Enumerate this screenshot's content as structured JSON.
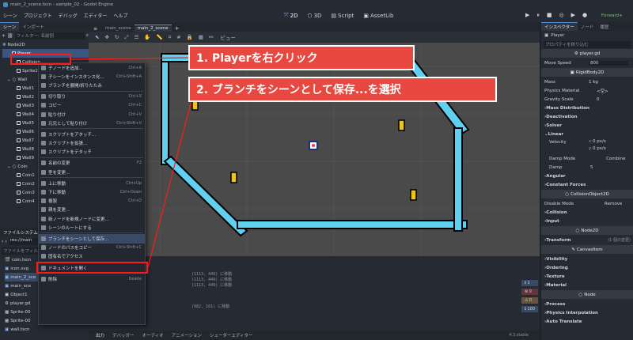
{
  "window": {
    "title": "main_2_scene.tscn - sample_02 - Godot Engine"
  },
  "menubar": {
    "items": [
      "シーン",
      "プロジェクト",
      "デバッグ",
      "エディター",
      "ヘルプ"
    ],
    "workspaces": [
      "2D",
      "3D",
      "Script",
      "AssetLib"
    ],
    "renderer": "Forward+"
  },
  "scene_dock": {
    "tabs": [
      "シーン",
      "インポート"
    ],
    "filter": "フィルター: 名前別",
    "root": "Node2D",
    "nodes": [
      "Player",
      "Collision",
      "Sprite2",
      "Wall",
      "Wall1",
      "Wall2",
      "Wall3",
      "Wall4",
      "Wall5",
      "Wall6",
      "Wall7",
      "Wall8",
      "Wall9",
      "Coin",
      "Coin1",
      "Coin2",
      "Coin3",
      "Coin4"
    ]
  },
  "filesystem": {
    "title": "ファイルシステム",
    "path": "res://main",
    "filter": "ファイルをフィル",
    "files": [
      "coin.tscn",
      "icon.svg",
      "main_2_sce",
      "main_sce",
      "Object1",
      "player.gd",
      "Sprite-00",
      "Sprite-00",
      "wall.tscn"
    ]
  },
  "editor_tabs": [
    "main_scene",
    "main_2_scene"
  ],
  "toolbar": {
    "view": "ビュー"
  },
  "context_menu": [
    {
      "label": "子ノードを追加...",
      "shortcut": "Ctrl+A"
    },
    {
      "label": "子シーンをインスタンス化...",
      "shortcut": "Ctrl+Shift+A"
    },
    {
      "label": "ブランチを展開/折りたたみ",
      "shortcut": ""
    },
    {
      "sep": true
    },
    {
      "label": "切り取り",
      "shortcut": "Ctrl+X"
    },
    {
      "label": "コピー",
      "shortcut": "Ctrl+C"
    },
    {
      "label": "貼り付け",
      "shortcut": "Ctrl+V"
    },
    {
      "label": "元兄として貼り付け",
      "shortcut": "Ctrl+Shift+V"
    },
    {
      "sep": true
    },
    {
      "label": "スクリプトをアタッチ...",
      "shortcut": ""
    },
    {
      "label": "スクリプトを拡張...",
      "shortcut": ""
    },
    {
      "label": "スクリプトをデタッチ",
      "shortcut": ""
    },
    {
      "sep": true
    },
    {
      "label": "名前の変更",
      "shortcut": "F2"
    },
    {
      "label": "型を変更...",
      "shortcut": ""
    },
    {
      "sep": true
    },
    {
      "label": "上に移動",
      "shortcut": "Ctrl+Up"
    },
    {
      "label": "下に移動",
      "shortcut": "Ctrl+Down"
    },
    {
      "label": "複製",
      "shortcut": "Ctrl+D"
    },
    {
      "label": "親を変更...",
      "shortcut": ""
    },
    {
      "label": "新ノードを新規ノードに変更...",
      "shortcut": ""
    },
    {
      "label": "シーンのルートにする",
      "shortcut": ""
    },
    {
      "sep": true
    },
    {
      "label": "ブランチをシーンとして保存...",
      "shortcut": ""
    },
    {
      "label": "ノードのパスをコピー",
      "shortcut": "Ctrl+Shift+C"
    },
    {
      "label": "固有名でアクセス",
      "shortcut": ""
    },
    {
      "sep": true
    },
    {
      "label": "ドキュメントを開く",
      "shortcut": ""
    },
    {
      "sep": true
    },
    {
      "label": "削除",
      "shortcut": "Delete"
    }
  ],
  "callouts": {
    "step1": "1. Playerを右クリック",
    "step2": "2. ブランチをシーンとして保存...を選択"
  },
  "output": {
    "lines": [
      "(1113, 449) に移動",
      "(1113, 449) に移動",
      "(1113, 449) に移動",
      "(982, 161) に移動"
    ]
  },
  "bottom_tabs": [
    "出力",
    "デバッガー",
    "オーディオ",
    "アニメーション",
    "シェーダーエディター"
  ],
  "version": "4.3.stable",
  "inspector": {
    "tabs": [
      "インスペクター",
      "ノード",
      "履歴"
    ],
    "node": "Player",
    "filter": "プロパティを絞り込む",
    "script": "player.gd",
    "move_speed_label": "Move Speed",
    "move_speed": "800",
    "class1": "RigidBody2D",
    "rows": [
      {
        "label": "Mass",
        "value": "1 kg"
      },
      {
        "label": "Physics Material",
        "value": "<空>"
      },
      {
        "label": "Gravity Scale",
        "value": "0"
      }
    ],
    "groups1": [
      "Mass Distribution",
      "Deactivation",
      "Solver",
      "Linear"
    ],
    "velocity": {
      "label": "Velocity",
      "x": "0 px/s",
      "y": "0 px/s"
    },
    "damp_mode": {
      "label": "Damp Mode",
      "value": "Combine"
    },
    "damp": {
      "label": "Damp",
      "value": "5"
    },
    "groups2": [
      "Angular",
      "Constant Forces"
    ],
    "class2": "CollisionObject2D",
    "disable_mode": {
      "label": "Disable Mode",
      "value": "Remove"
    },
    "groups3": [
      "Collision",
      "Input"
    ],
    "class3": "Node2D",
    "transform": {
      "label": "Transform",
      "value": "(1 個の変更)"
    },
    "class4": "CanvasItem",
    "groups4": [
      "Visibility",
      "Ordering",
      "Texture",
      "Material"
    ],
    "class5": "Node",
    "groups5": [
      "Process",
      "Physics Interpolation",
      "Auto Translate"
    ]
  },
  "colors": {
    "wall": "#5fd0ef",
    "callout": "#e8483f",
    "highlight": "#ff1a1a"
  }
}
